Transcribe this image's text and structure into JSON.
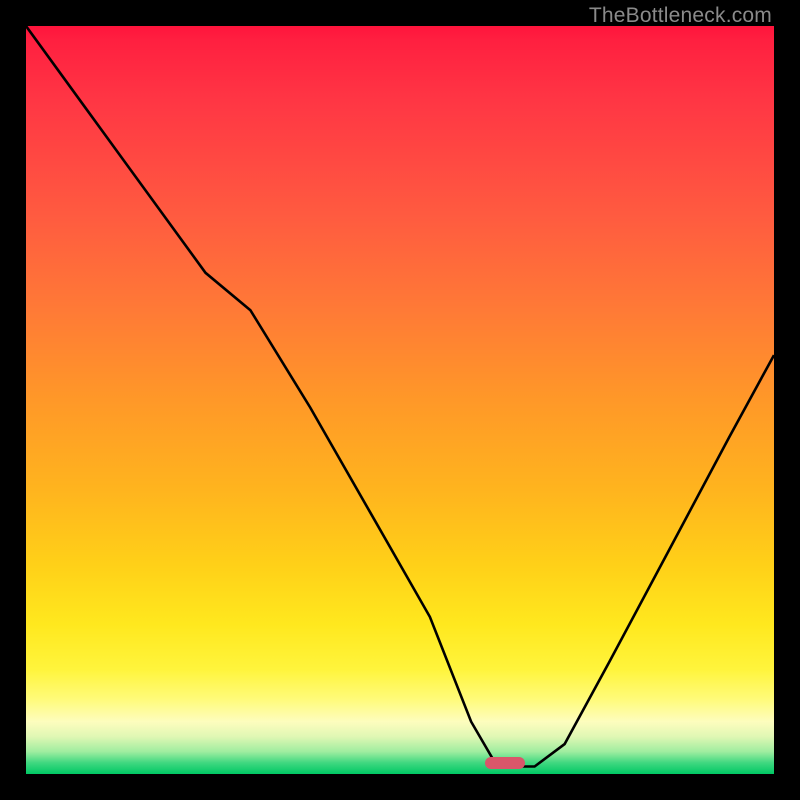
{
  "watermark": "TheBottleneck.com",
  "marker": {
    "x_frac": 0.64,
    "y_frac": 0.985
  },
  "chart_data": {
    "type": "line",
    "title": "",
    "xlabel": "",
    "ylabel": "",
    "xlim": [
      0,
      1
    ],
    "ylim": [
      0,
      1
    ],
    "series": [
      {
        "name": "bottleneck-curve",
        "x": [
          0.0,
          0.08,
          0.16,
          0.24,
          0.3,
          0.38,
          0.46,
          0.54,
          0.595,
          0.63,
          0.68,
          0.72,
          0.78,
          0.86,
          0.94,
          1.0
        ],
        "values": [
          1.0,
          0.89,
          0.78,
          0.67,
          0.62,
          0.49,
          0.35,
          0.21,
          0.07,
          0.01,
          0.01,
          0.04,
          0.15,
          0.3,
          0.45,
          0.56
        ]
      }
    ],
    "annotations": [
      {
        "name": "min-marker",
        "x": 0.655,
        "y": 0.01
      }
    ]
  }
}
